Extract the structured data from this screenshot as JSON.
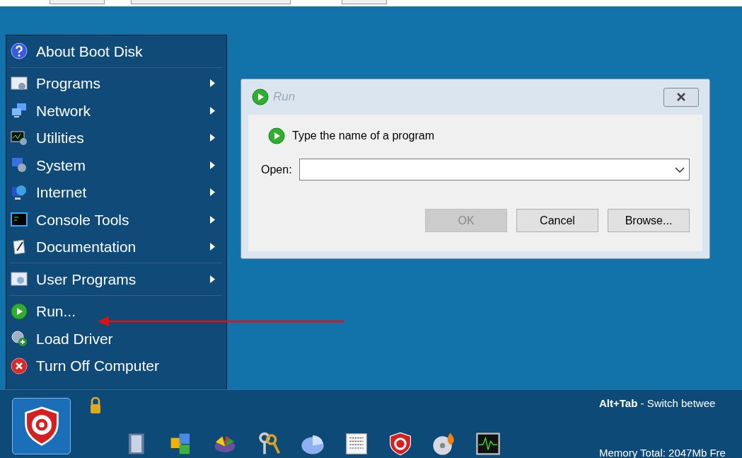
{
  "start_menu": {
    "sections": [
      [
        {
          "label": "About Boot Disk",
          "submenu": false
        }
      ],
      [
        {
          "label": "Programs",
          "submenu": true
        },
        {
          "label": "Network",
          "submenu": true
        },
        {
          "label": "Utilities",
          "submenu": true
        },
        {
          "label": "System",
          "submenu": true
        },
        {
          "label": "Internet",
          "submenu": true
        },
        {
          "label": "Console Tools",
          "submenu": true
        },
        {
          "label": "Documentation",
          "submenu": true
        }
      ],
      [
        {
          "label": "User Programs",
          "submenu": true
        }
      ],
      [
        {
          "label": "Run...",
          "submenu": false
        },
        {
          "label": "Load Driver",
          "submenu": false
        },
        {
          "label": "Turn Off Computer",
          "submenu": false
        }
      ]
    ]
  },
  "run_dialog": {
    "title": "Run",
    "prompt": "Type the name of a program",
    "open_label": "Open:",
    "buttons": [
      {
        "label": "OK",
        "disabled": true
      },
      {
        "label": "Cancel",
        "disabled": false
      },
      {
        "label": "Browse...",
        "disabled": false
      }
    ]
  },
  "taskbar": {
    "hotkey": "Alt+Tab",
    "hotkey_text": " - Switch betwee",
    "memory": "Memory Total: 2047Mb Fre"
  }
}
